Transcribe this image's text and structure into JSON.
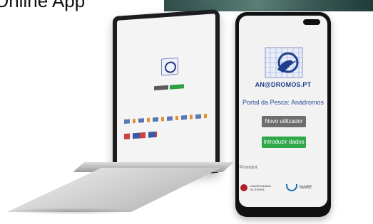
{
  "slide": {
    "title": "Online App"
  },
  "phone_app": {
    "app_name": "AN@DROMOS.PT",
    "subtitle": "Portal da Pesca: Anádromos",
    "buttons": {
      "new_user": "Novo utilizador",
      "enter_data": "Introduzir dados"
    },
    "promotor_label": "Promotor:",
    "partners": {
      "university_line1": "UNIVERSIDADE",
      "university_line2": "DE ÉVORA",
      "mare": "MARE"
    }
  },
  "colors": {
    "primary_blue": "#1f3f8c",
    "grey_button": "#6d6d6d",
    "green_button": "#2fa84a"
  }
}
